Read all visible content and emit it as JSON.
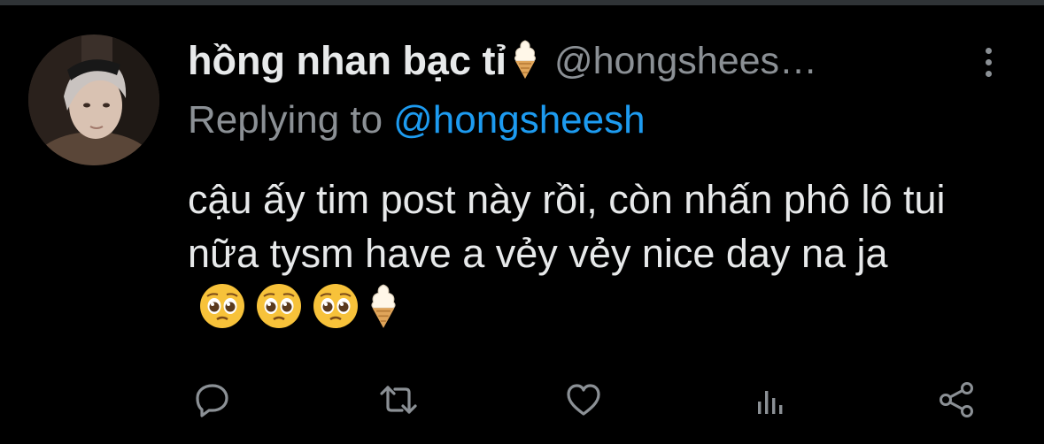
{
  "tweet": {
    "display_name": "hồng nhan bạc tỉ",
    "handle": "@hongshees…",
    "reply_prefix": "Replying to",
    "reply_handle": "@hongsheesh",
    "text": "cậu ấy tim post này rồi, còn nhấn phô lô tui nữa tysm have a vẻy vẻy nice day na ja"
  },
  "icons": {
    "name_emoji": "soft-ice-cream-icon",
    "text_emojis": [
      "pleading-face-icon",
      "pleading-face-icon",
      "pleading-face-icon",
      "soft-ice-cream-icon"
    ],
    "actions": [
      "reply-icon",
      "retweet-icon",
      "like-icon",
      "views-icon",
      "share-icon"
    ]
  },
  "colors": {
    "background": "#000000",
    "primary_text": "#e7e9ea",
    "secondary_text": "#8b9095",
    "link": "#1d9bf0",
    "icon": "#8b9095"
  }
}
